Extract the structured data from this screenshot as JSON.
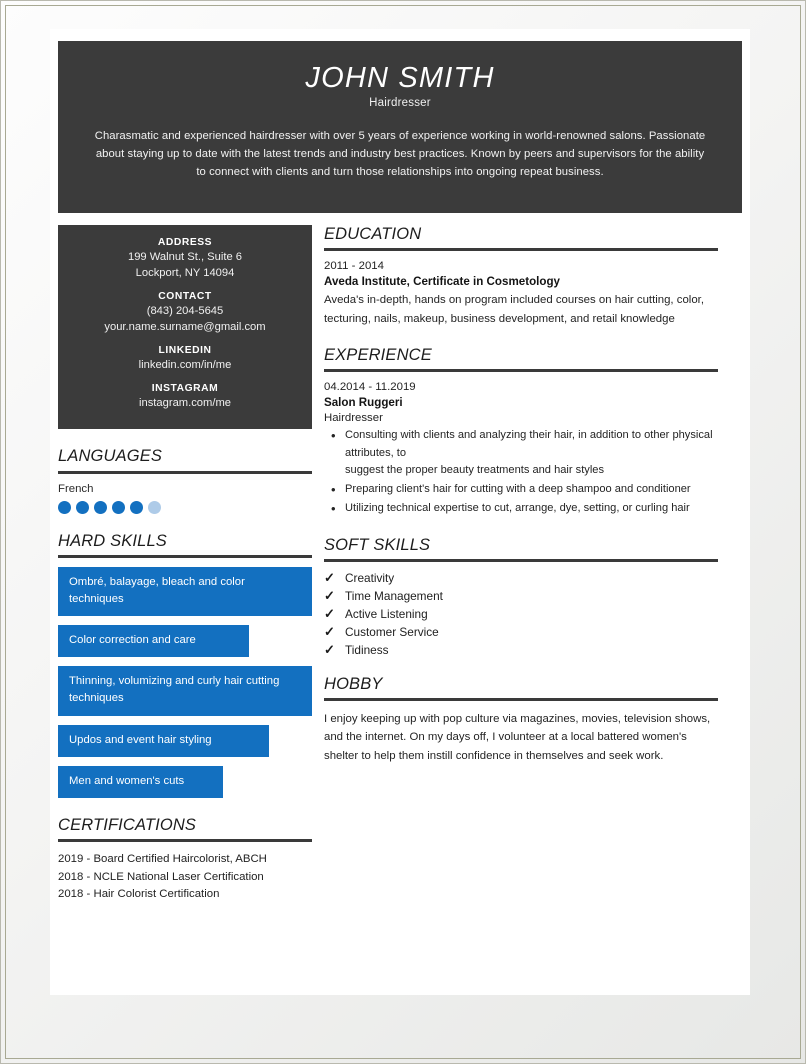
{
  "theme": {
    "dark_panel": "#3b3b3b",
    "accent_blue": "#1370c0",
    "accent_blue_light": "#aecbe8",
    "page_background": "#ffffff",
    "rule_color": "#3a3a3a"
  },
  "header": {
    "name": "JOHN SMITH",
    "job_title": "Hairdresser",
    "summary": "Charasmatic and experienced hairdresser with over 5 years of experience working in world-renowned salons. Passionate about staying up to date with the latest trends and industry best practices. Known by peers and supervisors for the ability to connect with clients and turn those relationships into ongoing repeat business."
  },
  "sidebar": {
    "contact_groups": [
      {
        "label": "ADDRESS",
        "lines": [
          "199 Walnut St., Suite 6",
          "Lockport, NY 14094"
        ]
      },
      {
        "label": "CONTACT",
        "lines": [
          "(843) 204-5645",
          "your.name.surname@gmail.com"
        ]
      },
      {
        "label": "LINKEDIN",
        "lines": [
          "linkedin.com/in/me"
        ]
      },
      {
        "label": "INSTAGRAM",
        "lines": [
          "instagram.com/me"
        ]
      }
    ],
    "languages": {
      "heading": "LANGUAGES",
      "items": [
        {
          "name": "French",
          "rating": 5,
          "total": 6
        }
      ]
    },
    "hard_skills": {
      "heading": "HARD SKILLS",
      "items": [
        {
          "label": "Ombré, balayage, bleach and color techniques",
          "width": "w-full"
        },
        {
          "label": "Color correction and care",
          "width": "w-mid"
        },
        {
          "label": "Thinning, volumizing and curly hair cutting techniques",
          "width": "w-full"
        },
        {
          "label": "Updos and event hair styling",
          "width": "w-wide"
        },
        {
          "label": "Men and women's cuts",
          "width": "w-small"
        }
      ]
    },
    "certifications": {
      "heading": "CERTIFICATIONS",
      "items": [
        "2019 - Board Certified Haircolorist, ABCH",
        "2018 - NCLE National Laser Certification",
        "2018 - Hair Colorist Certification"
      ]
    }
  },
  "main": {
    "education": {
      "heading": "EDUCATION",
      "entries": [
        {
          "dates": "2011 - 2014",
          "organization": "Aveda Institute, Certificate in Cosmetology",
          "description": "Aveda's in-depth, hands on program included courses on hair cutting, color, tecturing, nails, makeup, business development, and retail knowledge"
        }
      ]
    },
    "experience": {
      "heading": "EXPERIENCE",
      "entries": [
        {
          "dates": "04.2014 - 11.2019",
          "organization": "Salon Ruggeri",
          "role": "Hairdresser",
          "bullets": [
            "Consulting with clients and analyzing their hair, in addition to other physical attributes, to\nsuggest the proper beauty treatments and hair styles",
            "Preparing client's hair for cutting with a deep shampoo and conditioner",
            "Utilizing technical expertise to cut, arrange, dye, setting, or curling hair"
          ]
        }
      ]
    },
    "soft_skills": {
      "heading": "SOFT SKILLS",
      "check_glyph": "✓",
      "items": [
        "Creativity",
        "Time Management",
        "Active Listening",
        "Customer Service",
        "Tidiness"
      ]
    },
    "hobby": {
      "heading": "HOBBY",
      "text": "I enjoy keeping up with pop culture via magazines, movies, television shows, and the internet. On my days off, I volunteer at a local battered women's shelter to help them instill confidence in themselves and seek work."
    }
  }
}
